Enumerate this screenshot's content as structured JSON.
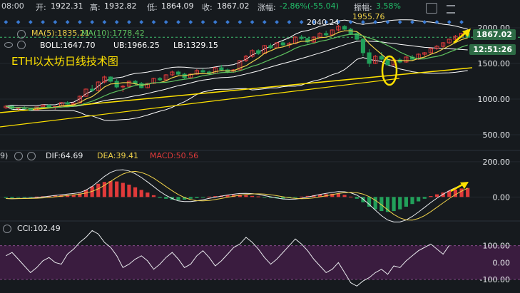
{
  "header": {
    "time": "08:00",
    "open_label": "开:",
    "open": "1922.31",
    "high_label": "高:",
    "high": "1932.82",
    "low_label": "低:",
    "low": "1864.09",
    "close_label": "收:",
    "close": "1867.02",
    "change_label": "涨幅:",
    "change": "-2.86%(-55.04)",
    "amplitude_label": "振幅:",
    "amplitude": "3.58%"
  },
  "main_panel": {
    "title": "ETH以太坊日线技术图",
    "ma5": "MA(5):1835.21",
    "ma10": "MA(10):1778.42",
    "boll": "BOLL:1647.70",
    "ub": "UB:1966.25",
    "lb": "LB:1329.15",
    "high_mark": "2040.24",
    "peak_mark": "1955.76",
    "price_tag": "1867.02",
    "countdown_tag": "12:51:26"
  },
  "macd_panel": {
    "dif": "DIF:64.69",
    "dea": "DEA:39.41",
    "macd": "MACD:50.56"
  },
  "cci_panel": {
    "cci": "CCI:102.49"
  },
  "colors": {
    "background": "#161a1e",
    "up": "#e03a3a",
    "down": "#22a05a",
    "ma5": "#f0d24a",
    "ma10": "#5fc25f",
    "boll": "#ffffff",
    "trend": "#ffe200",
    "cci_band": "#3a1c3f"
  },
  "chart_data": [
    {
      "type": "candlestick",
      "title": "ETH以太坊日线技术图",
      "y_ticks": [
        500,
        1000,
        1500,
        2000
      ],
      "ylim": [
        330,
        2150
      ],
      "ohlc": [
        [
          880,
          920,
          860,
          900
        ],
        [
          900,
          910,
          850,
          870
        ],
        [
          870,
          890,
          840,
          880
        ],
        [
          880,
          900,
          860,
          865
        ],
        [
          865,
          880,
          840,
          850
        ],
        [
          850,
          895,
          845,
          890
        ],
        [
          890,
          930,
          880,
          915
        ],
        [
          915,
          925,
          870,
          880
        ],
        [
          880,
          900,
          855,
          895
        ],
        [
          895,
          960,
          890,
          950
        ],
        [
          950,
          970,
          920,
          930
        ],
        [
          930,
          950,
          900,
          945
        ],
        [
          945,
          1050,
          940,
          1040
        ],
        [
          1040,
          1150,
          1030,
          1140
        ],
        [
          1140,
          1200,
          1100,
          1120
        ],
        [
          1120,
          1250,
          1110,
          1240
        ],
        [
          1240,
          1330,
          1220,
          1310
        ],
        [
          1310,
          1320,
          1230,
          1250
        ],
        [
          1250,
          1280,
          1150,
          1170
        ],
        [
          1170,
          1200,
          1100,
          1180
        ],
        [
          1180,
          1260,
          1170,
          1250
        ],
        [
          1250,
          1270,
          1200,
          1220
        ],
        [
          1220,
          1240,
          1150,
          1160
        ],
        [
          1160,
          1230,
          1150,
          1220
        ],
        [
          1220,
          1300,
          1210,
          1290
        ],
        [
          1290,
          1310,
          1250,
          1270
        ],
        [
          1270,
          1350,
          1260,
          1340
        ],
        [
          1340,
          1400,
          1320,
          1380
        ],
        [
          1380,
          1400,
          1330,
          1350
        ],
        [
          1350,
          1370,
          1280,
          1300
        ],
        [
          1300,
          1360,
          1290,
          1350
        ],
        [
          1350,
          1420,
          1340,
          1400
        ],
        [
          1400,
          1430,
          1370,
          1380
        ],
        [
          1380,
          1400,
          1340,
          1360
        ],
        [
          1360,
          1450,
          1350,
          1440
        ],
        [
          1440,
          1480,
          1400,
          1410
        ],
        [
          1410,
          1430,
          1360,
          1380
        ],
        [
          1380,
          1420,
          1370,
          1410
        ],
        [
          1410,
          1550,
          1400,
          1540
        ],
        [
          1540,
          1620,
          1520,
          1600
        ],
        [
          1600,
          1700,
          1580,
          1680
        ],
        [
          1680,
          1700,
          1620,
          1640
        ],
        [
          1640,
          1760,
          1630,
          1750
        ],
        [
          1750,
          1780,
          1700,
          1720
        ],
        [
          1720,
          1800,
          1710,
          1790
        ],
        [
          1790,
          1820,
          1740,
          1760
        ],
        [
          1760,
          1800,
          1720,
          1780
        ],
        [
          1780,
          1880,
          1770,
          1870
        ],
        [
          1870,
          1900,
          1830,
          1850
        ],
        [
          1850,
          1860,
          1780,
          1800
        ],
        [
          1800,
          1880,
          1790,
          1870
        ],
        [
          1870,
          1940,
          1860,
          1920
        ],
        [
          1920,
          1960,
          1880,
          1900
        ],
        [
          1900,
          1980,
          1890,
          1970
        ],
        [
          1970,
          2040,
          1950,
          2020
        ],
        [
          2020,
          2040,
          1960,
          1980
        ],
        [
          1980,
          2000,
          1900,
          1920
        ],
        [
          1920,
          1950,
          1820,
          1840
        ],
        [
          1840,
          1860,
          1600,
          1650
        ],
        [
          1650,
          1700,
          1450,
          1500
        ],
        [
          1500,
          1620,
          1490,
          1600
        ],
        [
          1600,
          1660,
          1540,
          1560
        ],
        [
          1560,
          1580,
          1470,
          1480
        ],
        [
          1480,
          1560,
          1470,
          1550
        ],
        [
          1550,
          1580,
          1500,
          1520
        ],
        [
          1520,
          1600,
          1510,
          1590
        ],
        [
          1590,
          1620,
          1540,
          1560
        ],
        [
          1560,
          1640,
          1550,
          1630
        ],
        [
          1630,
          1660,
          1600,
          1650
        ],
        [
          1650,
          1720,
          1640,
          1710
        ],
        [
          1710,
          1760,
          1690,
          1740
        ],
        [
          1740,
          1800,
          1720,
          1790
        ],
        [
          1790,
          1850,
          1770,
          1840
        ],
        [
          1840,
          1900,
          1820,
          1880
        ],
        [
          1880,
          1930,
          1860,
          1922
        ],
        [
          1922,
          1933,
          1864,
          1867
        ]
      ]
    },
    {
      "type": "bar",
      "title": "MACD",
      "y_ticks": [
        0,
        200
      ],
      "ylim": [
        -120,
        260
      ],
      "values": [
        -5,
        -6,
        -4,
        -3,
        -2,
        2,
        4,
        6,
        8,
        10,
        12,
        14,
        20,
        40,
        60,
        75,
        85,
        90,
        88,
        80,
        70,
        55,
        40,
        25,
        10,
        -5,
        -10,
        -15,
        -18,
        -15,
        -10,
        -6,
        -4,
        2,
        5,
        8,
        10,
        12,
        14,
        10,
        6,
        3,
        -2,
        -5,
        -8,
        -10,
        -6,
        -3,
        2,
        6,
        10,
        14,
        16,
        18,
        20,
        12,
        2,
        -10,
        -30,
        -55,
        -70,
        -80,
        -85,
        -80,
        -70,
        -55,
        -40,
        -25,
        -10,
        5,
        15,
        25,
        35,
        42,
        48,
        51
      ]
    },
    {
      "type": "line",
      "title": "CCI",
      "y_ticks": [
        -100,
        0,
        100
      ],
      "ylim": [
        -160,
        230
      ],
      "values": [
        40,
        60,
        20,
        -20,
        -60,
        -30,
        10,
        30,
        0,
        -10,
        50,
        80,
        120,
        150,
        190,
        170,
        120,
        90,
        40,
        -30,
        -10,
        20,
        40,
        10,
        -40,
        -10,
        30,
        60,
        20,
        -30,
        -10,
        40,
        70,
        30,
        -20,
        10,
        50,
        90,
        110,
        150,
        120,
        80,
        30,
        -10,
        20,
        60,
        100,
        140,
        110,
        70,
        20,
        -20,
        -60,
        -40,
        0,
        -60,
        -120,
        -140,
        -110,
        -90,
        -60,
        -40,
        -70,
        -20,
        -30,
        10,
        40,
        70,
        90,
        110,
        80,
        50,
        102
      ]
    }
  ]
}
